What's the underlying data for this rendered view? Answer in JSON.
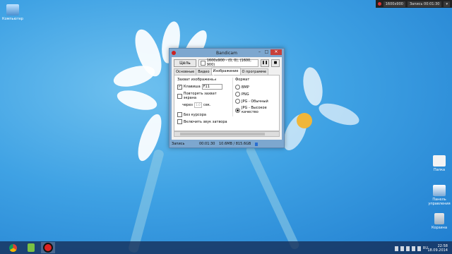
{
  "desktop": {
    "icons": [
      {
        "label": "Компьютер"
      },
      {
        "label": "Папка"
      },
      {
        "label": "Панель управления"
      },
      {
        "label": "Корзина"
      }
    ]
  },
  "recording_bar": {
    "resolution": "1600x900",
    "status": "Запись 00:01:30"
  },
  "window": {
    "title": "Bandicam",
    "target_button": "Цель",
    "region_text": "1600x900 - (0, 0), (1600, 900)",
    "tabs": [
      "Основные",
      "Видео",
      "Изображение",
      "О программе"
    ],
    "active_tab": 2,
    "capture_group": "Захват изображения",
    "hotkey_label": "Клавиша",
    "hotkey_value": "F11",
    "repeat_label_1": "Повторять захват экрана",
    "repeat_label_2": "через",
    "repeat_value": "1.0",
    "repeat_unit": "сек.",
    "no_cursor": "Без курсора",
    "shutter_sound": "Включить звук затвора",
    "format_group": "Формат",
    "formats": [
      "BMP",
      "PNG",
      "JPG - Обычный",
      "JPG - Высокое качество"
    ],
    "selected_format": 3,
    "status_label": "Запись",
    "status_time": "00:01:30",
    "status_size": "10.6MB / 815.6GB"
  },
  "taskbar": {
    "time": "22:58",
    "date": "18.09.2014",
    "lang": "RU"
  },
  "colors": {
    "desktop_blue": "#3fa2e4",
    "window_frame": "#7da7cf",
    "close_red": "#c7403a"
  }
}
